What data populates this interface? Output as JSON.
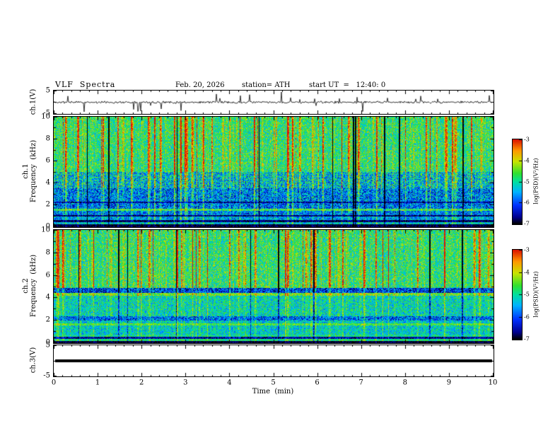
{
  "title": {
    "main": "VLF  Spectra",
    "date": "Feb. 20, 2026",
    "station": "station= ATH",
    "start_ut": "start UT  =   12:40: 0"
  },
  "labels": {
    "ch1v": "ch.1(V)",
    "ch1": "ch.1",
    "ch2": "ch.2",
    "freq": "Frequency  (kHz)",
    "ch3v": "ch.3(V)",
    "time": "Time  (min)"
  },
  "axes": {
    "time_ticks": [
      0,
      1,
      2,
      3,
      4,
      5,
      6,
      7,
      8,
      9,
      10
    ],
    "freq_ticks": [
      0,
      2,
      4,
      6,
      8,
      10
    ],
    "volt_ticks": [
      5,
      -5
    ]
  },
  "colorbar": {
    "label": "log(PSD)(V²/Hz)",
    "ticks": [
      -3,
      -4,
      -5,
      -6,
      -7
    ],
    "zlim": [
      -7,
      -3
    ],
    "colormap": {
      "name": "jet-like",
      "stops": [
        {
          "t": 0.0,
          "color": "#000000"
        },
        {
          "t": 0.08,
          "color": "#00008f"
        },
        {
          "t": 0.22,
          "color": "#0030ff"
        },
        {
          "t": 0.38,
          "color": "#00b4ff"
        },
        {
          "t": 0.5,
          "color": "#00e0a0"
        },
        {
          "t": 0.6,
          "color": "#30e030"
        },
        {
          "t": 0.74,
          "color": "#c8e400"
        },
        {
          "t": 0.87,
          "color": "#ff9800"
        },
        {
          "t": 1.0,
          "color": "#dc1400"
        }
      ]
    }
  },
  "chart_data": [
    {
      "type": "line",
      "name": "ch1_waveform",
      "ylabel": "ch.1(V)",
      "ylim": [
        -5,
        5
      ],
      "xlim": [
        0,
        10
      ],
      "description": "Channel 1 receiver voltage vs time: continuous noise near 0 V (about ±0.5 V) with frequent impulsive sferic spikes reaching ±5 V throughout the 10 minutes",
      "noise_v": 0.55,
      "spike_prob": 0.055,
      "spike_vmax": 4.6,
      "seed": 11
    },
    {
      "type": "heatmap",
      "name": "ch1_spectrogram",
      "ylabel": "ch.1 Frequency (kHz)",
      "xlim": [
        0,
        10
      ],
      "ylim": [
        0,
        10
      ],
      "zlabel": "log(PSD)(V²/Hz)",
      "zlim": [
        -7,
        -3
      ],
      "seed": 21,
      "description": "VLF spectrogram ch.1: broadband green noise ~-5 above 5 kHz crossed by many red/orange vertical sferic stripes and a few black dropouts; bluer speckled power (-5.5 to -6) between 1.5 and 5 kHz; narrow dark horizontal bands near 0.5, 1.0 and 2.2 kHz; brighter line near 1.6 kHz; near-black below 0.25 kHz",
      "stripes": {
        "dark_prob": 0.025,
        "strong_prob": 0.115,
        "strong_min": 0.7,
        "strong_max": 2.4,
        "weak_prob": 0.31,
        "weak_max": 0.7
      },
      "bands": [
        {
          "f0": 0.0,
          "f1": 0.25,
          "base": -6.9,
          "noise": 0.25,
          "stripe": 0.15
        },
        {
          "f0": 0.25,
          "f1": 0.45,
          "base": -5.3,
          "noise": 0.7,
          "stripe": 0.4
        },
        {
          "f0": 0.45,
          "f1": 0.62,
          "base": -6.8,
          "noise": 0.4,
          "stripe": 0.2
        },
        {
          "f0": 0.62,
          "f1": 0.95,
          "base": -5.6,
          "noise": 0.8,
          "stripe": 0.5
        },
        {
          "f0": 0.95,
          "f1": 1.1,
          "base": -6.8,
          "noise": 0.35,
          "stripe": 0.2
        },
        {
          "f0": 1.1,
          "f1": 1.5,
          "base": -5.8,
          "noise": 0.9,
          "stripe": 0.5
        },
        {
          "f0": 1.5,
          "f1": 1.68,
          "base": -4.7,
          "noise": 0.7,
          "stripe": 0.4
        },
        {
          "f0": 1.68,
          "f1": 2.15,
          "base": -5.9,
          "noise": 0.95,
          "stripe": 0.55
        },
        {
          "f0": 2.15,
          "f1": 2.3,
          "base": -6.7,
          "noise": 0.45,
          "stripe": 0.3
        },
        {
          "f0": 2.3,
          "f1": 3.5,
          "base": -5.8,
          "noise": 1.0,
          "stripe": 0.6
        },
        {
          "f0": 3.5,
          "f1": 5.0,
          "base": -5.4,
          "noise": 1.05,
          "stripe": 0.85
        },
        {
          "f0": 5.0,
          "f1": 10.0,
          "base": -4.85,
          "noise": 0.8,
          "stripe": 1.0
        }
      ]
    },
    {
      "type": "heatmap",
      "name": "ch2_spectrogram",
      "ylabel": "ch.2 Frequency (kHz)",
      "xlim": [
        0,
        10
      ],
      "ylim": [
        0,
        10
      ],
      "zlabel": "log(PSD)(V²/Hz)",
      "zlim": [
        -7,
        -3
      ],
      "seed": 31,
      "description": "VLF spectrogram ch.2: green broadband noise ~-5 above 5 kHz with red/black vertical sferic stripes; bright orange line near 4.3 kHz over a dark band 4.5-4.8 kHz; smooth green/cyan texture 2.4-4.2 kHz; grey-dark segmented band near 2-2.3 kHz; bright lines near 0.3, 0.7 and 1.6 kHz; black below 0.2 kHz",
      "stripes": {
        "dark_prob": 0.025,
        "strong_prob": 0.115,
        "strong_min": 0.7,
        "strong_max": 2.4,
        "weak_prob": 0.31,
        "weak_max": 0.7
      },
      "bands": [
        {
          "f0": 0.0,
          "f1": 0.2,
          "base": -6.9,
          "noise": 0.25,
          "stripe": 0.1
        },
        {
          "f0": 0.2,
          "f1": 0.38,
          "base": -4.9,
          "noise": 0.55,
          "stripe": 0.3
        },
        {
          "f0": 0.38,
          "f1": 0.56,
          "base": -6.6,
          "noise": 0.5,
          "stripe": 0.2
        },
        {
          "f0": 0.56,
          "f1": 0.78,
          "base": -5.0,
          "noise": 0.6,
          "stripe": 0.3
        },
        {
          "f0": 0.78,
          "f1": 1.55,
          "base": -5.25,
          "noise": 0.7,
          "stripe": 0.35
        },
        {
          "f0": 1.55,
          "f1": 1.72,
          "base": -4.6,
          "noise": 0.55,
          "stripe": 0.3
        },
        {
          "f0": 1.72,
          "f1": 2.0,
          "base": -5.3,
          "noise": 0.7,
          "stripe": 0.35
        },
        {
          "f0": 2.0,
          "f1": 2.35,
          "base": -5.9,
          "noise": 0.95,
          "stripe": 0.3
        },
        {
          "f0": 2.35,
          "f1": 4.2,
          "base": -5.15,
          "noise": 0.75,
          "stripe": 0.4
        },
        {
          "f0": 4.2,
          "f1": 4.45,
          "base": -4.45,
          "noise": 0.7,
          "stripe": 0.5
        },
        {
          "f0": 4.45,
          "f1": 4.85,
          "base": -6.2,
          "noise": 0.9,
          "stripe": 0.5
        },
        {
          "f0": 4.85,
          "f1": 10.0,
          "base": -4.85,
          "noise": 0.8,
          "stripe": 1.0
        }
      ]
    },
    {
      "type": "line",
      "name": "ch3_waveform",
      "ylabel": "ch.3(V)",
      "ylim": [
        -5,
        5
      ],
      "xlim": [
        0,
        10
      ],
      "constant_value": 0,
      "description": "Channel 3 voltage: flat thick line at 0 V for the whole interval (no signal)"
    }
  ]
}
